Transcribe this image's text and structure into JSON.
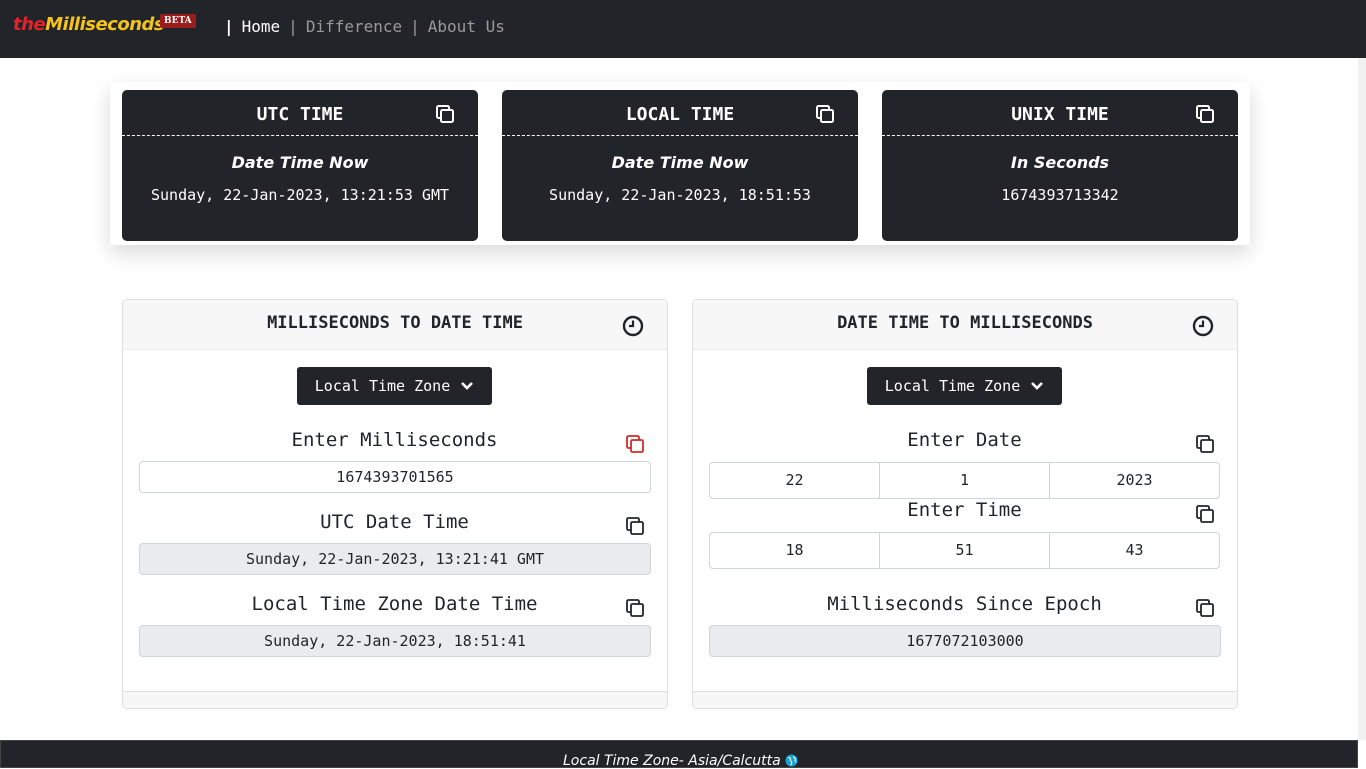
{
  "brand": {
    "the": "the",
    "milliseconds": "Milliseconds",
    "badge": "BETA"
  },
  "nav": {
    "items": [
      {
        "label": "Home"
      },
      {
        "label": "Difference"
      },
      {
        "label": "About Us"
      }
    ]
  },
  "time_cards": [
    {
      "title": "UTC TIME",
      "subtitle": "Date Time Now",
      "value": "Sunday, 22-Jan-2023, 13:21:53 GMT"
    },
    {
      "title": "LOCAL TIME",
      "subtitle": "Date Time Now",
      "value": "Sunday, 22-Jan-2023, 18:51:53"
    },
    {
      "title": "UNIX TIME",
      "subtitle": "In Seconds",
      "value": "1674393713342"
    }
  ],
  "ms_to_date": {
    "title": "MILLISECONDS TO DATE TIME",
    "timezone_button": "Local Time Zone",
    "enter_label": "Enter Milliseconds",
    "ms_value": "1674393701565",
    "utc_label": "UTC Date Time",
    "utc_value": "Sunday, 22-Jan-2023, 13:21:41 GMT",
    "local_label": "Local Time Zone Date Time",
    "local_value": "Sunday, 22-Jan-2023, 18:51:41"
  },
  "date_to_ms": {
    "title": "DATE TIME TO MILLISECONDS",
    "timezone_button": "Local Time Zone",
    "date_label": "Enter Date",
    "day": "22",
    "month": "1",
    "year": "2023",
    "time_label": "Enter Time",
    "hour": "18",
    "minute": "51",
    "second": "43",
    "epoch_label": "Milliseconds Since Epoch",
    "epoch_value": "1677072103000"
  },
  "footer": {
    "text": "Local Time Zone- Asia/Calcutta"
  },
  "icons": {
    "copy": "copy-icon",
    "clock": "clock-icon",
    "chevron": "chevron-down-icon",
    "globe": "globe-icon"
  },
  "colors": {
    "dark": "#212529",
    "accent_red": "#e3222a",
    "accent_yellow": "#f6c21c",
    "copy_active": "#d12b2b",
    "globe": "#17a2d6"
  }
}
